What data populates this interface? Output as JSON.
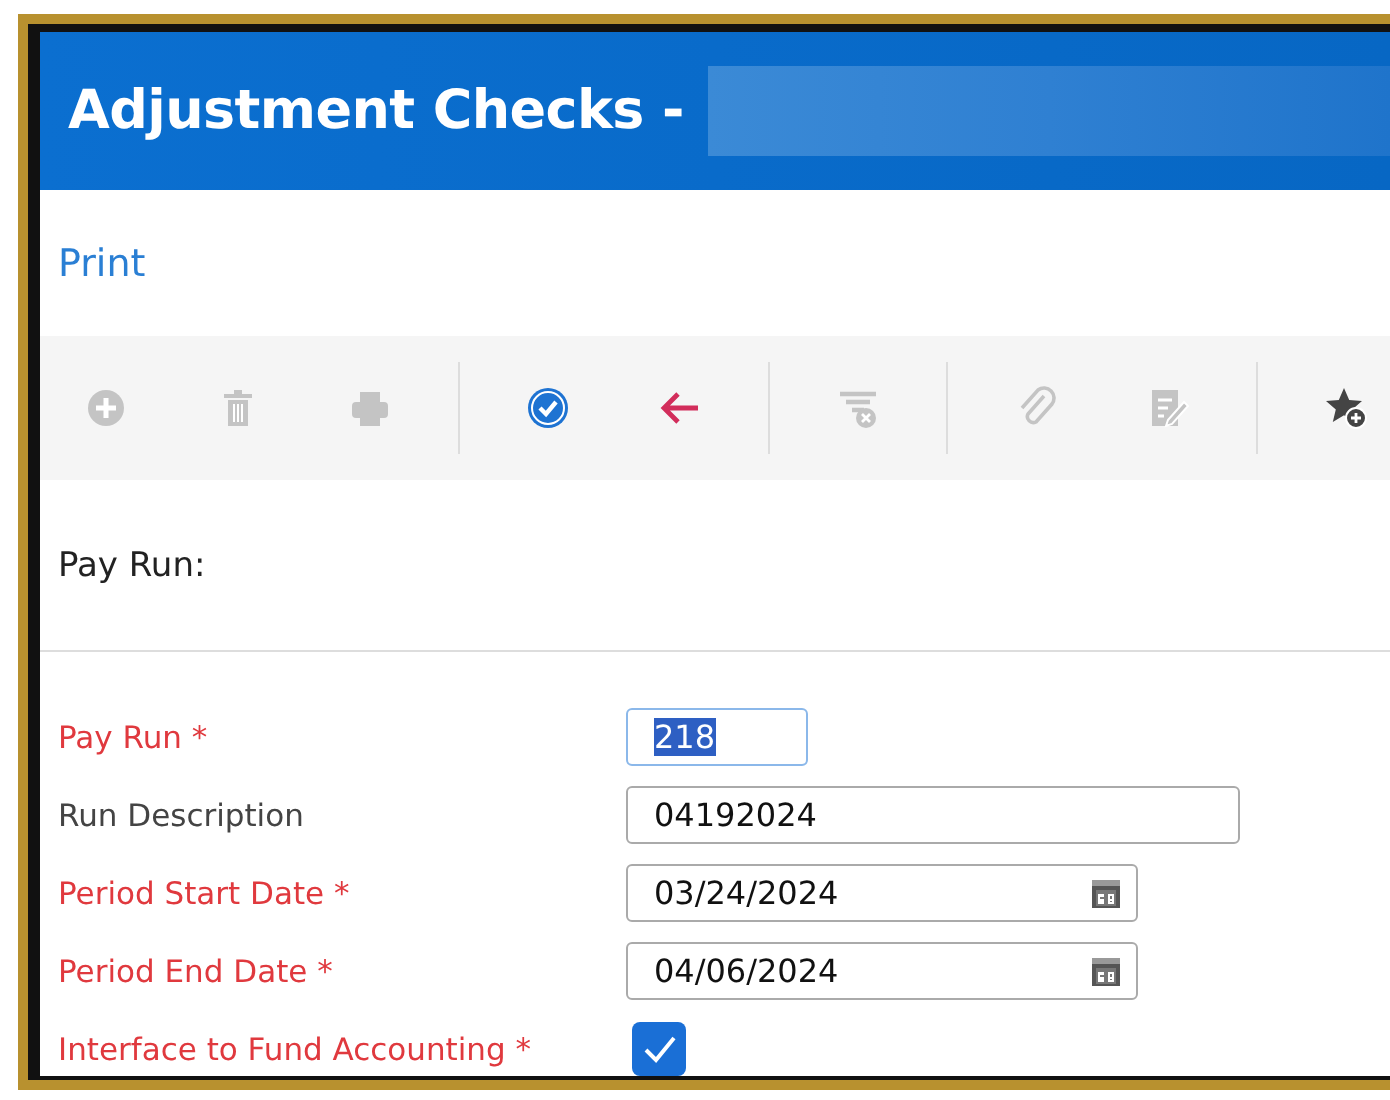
{
  "window": {
    "title": "Adjustment Checks -"
  },
  "actions": [
    {
      "label": "Print"
    }
  ],
  "toolbar": [
    {
      "kind": "add",
      "disabled": true
    },
    {
      "kind": "delete",
      "disabled": true
    },
    {
      "kind": "print",
      "disabled": true
    },
    {
      "kind": "separator"
    },
    {
      "kind": "confirm",
      "disabled": false
    },
    {
      "kind": "back",
      "disabled": false
    },
    {
      "kind": "separator"
    },
    {
      "kind": "filter",
      "disabled": true
    },
    {
      "kind": "separator"
    },
    {
      "kind": "attach",
      "disabled": true
    },
    {
      "kind": "edit",
      "disabled": true
    },
    {
      "kind": "separator"
    },
    {
      "kind": "favorite",
      "disabled": false
    }
  ],
  "section": {
    "title": "Pay Run:"
  },
  "fields": [
    {
      "kind": "number",
      "label": "Pay Run *",
      "required": true,
      "value": "218",
      "focused": true
    },
    {
      "kind": "text",
      "label": "Run Description",
      "required": false,
      "value": "04192024",
      "focused": false
    },
    {
      "kind": "date",
      "label": "Period Start Date *",
      "required": true,
      "value": "03/24/2024",
      "focused": false
    },
    {
      "kind": "date",
      "label": "Period End Date *",
      "required": true,
      "value": "04/06/2024",
      "focused": false
    },
    {
      "kind": "checkbox",
      "label": "Interface to Fund Accounting *",
      "required": true,
      "checked": true
    }
  ]
}
